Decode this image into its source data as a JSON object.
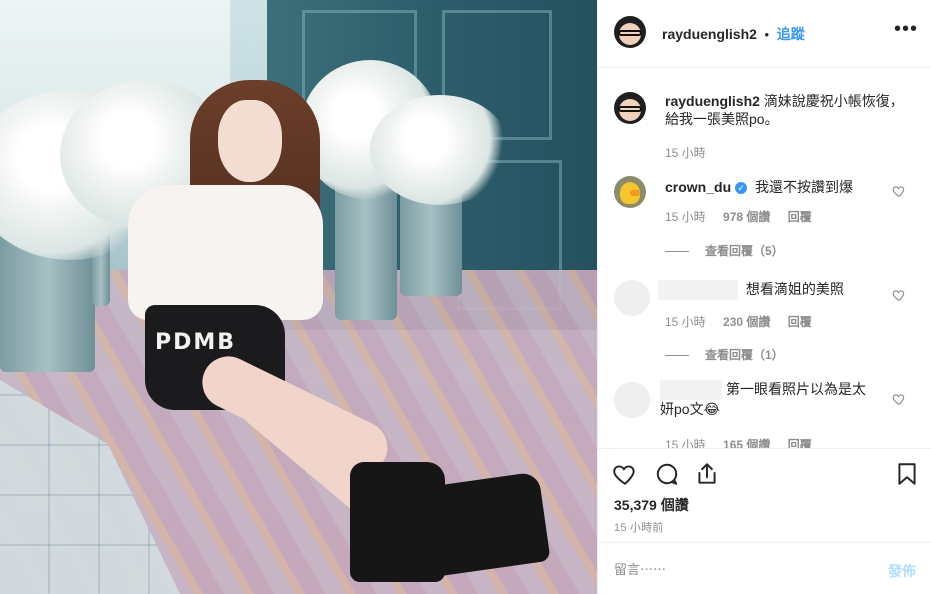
{
  "photo": {
    "alt_icon": "post-photo",
    "skirt_text": "PDMB"
  },
  "header": {
    "username": "rayduenglish2",
    "separator": "•",
    "follow_label": "追蹤",
    "more_label": "•••"
  },
  "caption": {
    "username": "rayduenglish2",
    "text": "滴妹說慶祝小帳恢復，",
    "text_line2": "給我一張美照po。",
    "time": "15 小時"
  },
  "comments": [
    {
      "username": "crown_du",
      "verified": true,
      "text": "我還不按讚到爆",
      "time": "15 小時",
      "likes": "978 個讚",
      "reply_label": "回覆",
      "view_replies": "查看回覆（5）"
    },
    {
      "username": "",
      "text": "想看滴姐的美照",
      "time": "15 小時",
      "likes": "230 個讚",
      "reply_label": "回覆",
      "view_replies": "查看回覆（1）"
    },
    {
      "username": "",
      "text": "第一眼看照片以為是太",
      "text_line2": "妍po文😂",
      "time": "15 小時",
      "likes": "165 個讚",
      "reply_label": "回覆"
    }
  ],
  "actions": {
    "icons": [
      "heart-icon",
      "comment-icon",
      "share-icon",
      "bookmark-icon"
    ],
    "likes_count": "35,379 個讚",
    "posted_ago": "15 小時前"
  },
  "add_comment": {
    "placeholder": "留言⋯⋯",
    "post_label": "發佈"
  },
  "colors": {
    "link_blue": "#3897f0",
    "post_disabled": "#b2dffc",
    "muted": "#8e8e8e",
    "text": "#262626"
  }
}
